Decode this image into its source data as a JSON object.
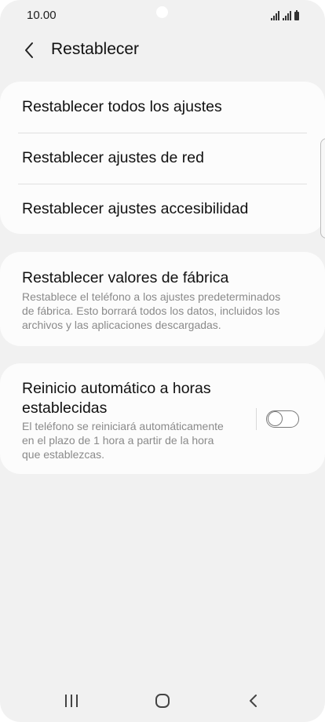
{
  "status_bar": {
    "time": "10.00",
    "icons": [
      "signal-icon",
      "signal-icon",
      "battery-icon"
    ]
  },
  "header": {
    "title": "Restablecer",
    "back_icon": "back-arrow-icon"
  },
  "reset_options": [
    {
      "label": "Restablecer todos los ajustes"
    },
    {
      "label": "Restablecer ajustes de red"
    },
    {
      "label": "Restablecer ajustes accesibilidad"
    }
  ],
  "factory_reset": {
    "title": "Restablecer valores de fábrica",
    "description_lines": [
      "Restablece el teléfono a los ajustes predeterminados",
      "de fábrica. Esto borrará todos los datos, incluidos los",
      "archivos y las aplicaciones descargadas."
    ]
  },
  "auto_restart": {
    "title_lines": [
      "Reinicio automático a horas",
      "establecidas"
    ],
    "description_lines": [
      "El teléfono se reiniciará automáticamente",
      "en el plazo de 1 hora a partir de la hora",
      "que establezcas."
    ],
    "toggle_on": false
  },
  "nav_bar": {
    "icons": [
      "recent-apps-icon",
      "home-icon",
      "back-icon"
    ]
  },
  "colors": {
    "background": "#f1f1f1",
    "card": "#fcfcfc",
    "text_primary": "#111111",
    "text_secondary": "#8a8a8a"
  }
}
